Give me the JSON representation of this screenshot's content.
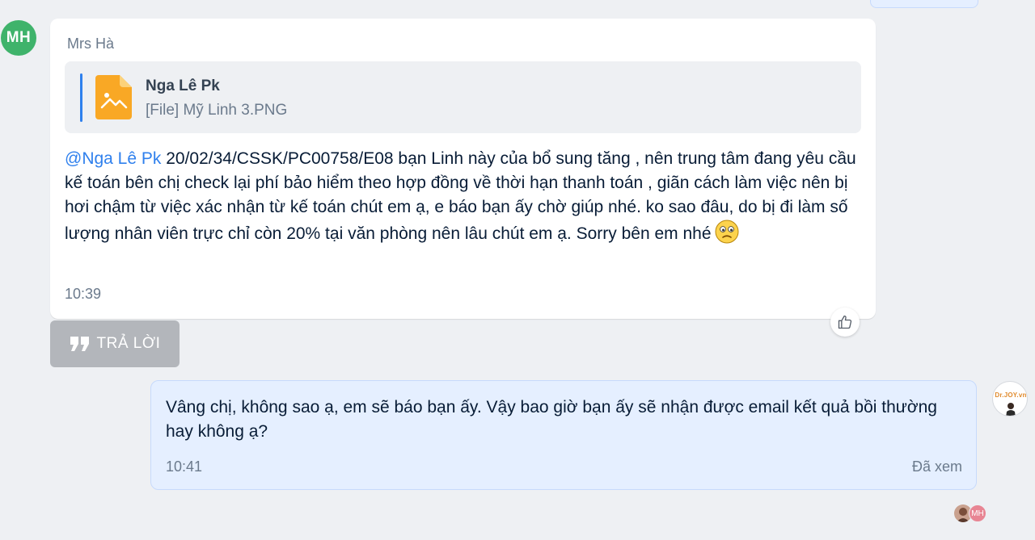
{
  "incoming": {
    "avatar_initials": "MH",
    "sender": "Mrs Hà",
    "quote": {
      "name": "Nga Lê Pk",
      "file_label": "[File] Mỹ Linh 3.PNG",
      "icon": "image-file-icon"
    },
    "mention": "@Nga Lê Pk",
    "text": " 20/02/34/CSSK/PC00758/E08 bạn Linh này của bổ sung tăng , nên trung tâm đang yêu cầu kế toán bên chị check lại phí bảo hiểm theo hợp đồng về thời hạn thanh toán , giãn cách làm việc nên bị hơi chậm từ việc xác nhận từ kế toán chút em ạ, e báo bạn ấy chờ giúp nhé. ko sao đâu, do bị đi làm số lượng nhân viên trực chỉ còn 20% tại văn phòng nên lâu chút em ạ. Sorry bên em nhé",
    "emoji": "sad-face-emoji",
    "time": "10:39"
  },
  "reply_button": {
    "label": "TRẢ LỜI",
    "icon": "quote-icon"
  },
  "like_button": {
    "icon": "thumbs-up-icon"
  },
  "outgoing": {
    "text": "Vâng chị, không sao ạ, em sẽ báo bạn ấy. Vậy bao giờ bạn ấy sẽ nhận được email kết quả bồi thường hay không ạ?",
    "time": "10:41",
    "status": "Đã xem",
    "avatar_brand": "Dr.JOY.vn"
  },
  "seen_by": {
    "initials": "MH"
  },
  "colors": {
    "background": "#eef0f3",
    "incoming_bubble": "#ffffff",
    "outgoing_bubble": "#e5efff",
    "mention": "#2f80ed",
    "avatar_mh": "#3fb36b",
    "reply_button": "#b3b6bb",
    "file_icon": "#f9a825"
  }
}
